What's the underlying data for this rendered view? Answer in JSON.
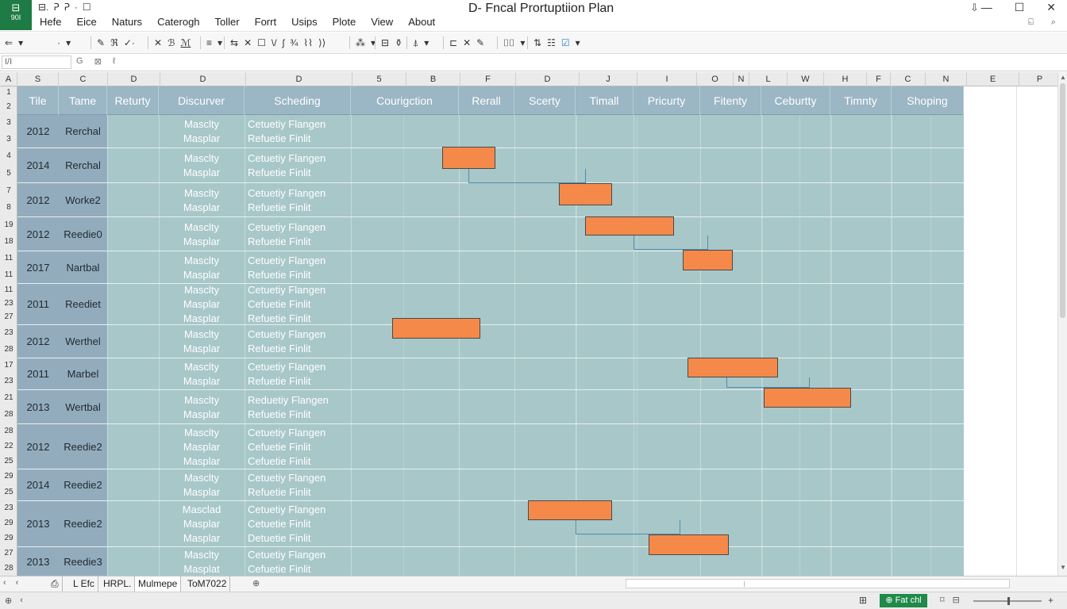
{
  "app": {
    "icon_glyph": "⊟",
    "icon_label": "90I",
    "title": "D- Fncal Prortuptiion Plan",
    "quick_access": [
      "⊟.",
      "ᕈ",
      "ᕈ",
      "·",
      "☐"
    ],
    "menu": [
      "Hefe",
      "Eice",
      "Naturs",
      "Caterogh",
      "Toller",
      "Forrt",
      "Usips",
      "Plote",
      "View",
      "About"
    ],
    "window_controls": [
      "⇩",
      "—",
      "☐",
      "✕"
    ],
    "title_right_icons": [
      "⍇",
      "⌕"
    ]
  },
  "ribbon": {
    "groups": [
      [
        "⇐",
        "▾",
        "·",
        "▾"
      ],
      [
        "✎",
        "ℜ",
        "✓·"
      ],
      [
        "✕",
        "ℬ",
        "ℳ"
      ],
      [
        "≡",
        "▾"
      ],
      [
        "⇆",
        "✕",
        "☐",
        "\\/",
        "ʃ",
        "¾",
        "⌇⌇",
        "⟩⟩"
      ],
      [
        "⁂",
        "▾"
      ],
      [
        "⊟",
        "⚱"
      ],
      [
        "⍋",
        "▾"
      ],
      [
        "⊏",
        "✕",
        "✎"
      ],
      [
        "⌷⌷",
        "▾"
      ],
      [
        "⇅",
        "☷",
        "☑",
        "▾"
      ]
    ]
  },
  "formula_bar": {
    "name_box": "I/I",
    "icons": [
      "G",
      "⊠",
      "ℓ"
    ]
  },
  "columns": [
    "A",
    "S",
    "C",
    "D",
    "D",
    "D",
    "5",
    "B",
    "F",
    "D",
    "J",
    "I",
    "O",
    "N",
    "L",
    "W",
    "H",
    "F",
    "C",
    "N",
    "E",
    "P"
  ],
  "headers": [
    "Tile",
    "Tame",
    "Returty",
    "Discurver",
    "Scheding",
    "Courigction",
    "Rerall",
    "Scerty",
    "Timall",
    "Pricurty",
    "Fitenty",
    "Ceburtty",
    "Timnty",
    "Shoping"
  ],
  "rows": [
    {
      "year": "2012",
      "name": "Rerchal",
      "nums": [
        "3",
        "3"
      ],
      "d": [
        "Masclty",
        "Masplar"
      ],
      "e": [
        "Cetuetiy Flangen",
        "Refuetie Finlit"
      ]
    },
    {
      "year": "2014",
      "name": "Rerchal",
      "nums": [
        "4",
        "5"
      ],
      "d": [
        "Masclty",
        "Masplar"
      ],
      "e": [
        "Cetuetiy Flangen",
        "Refuetie Finlit"
      ]
    },
    {
      "year": "2012",
      "name": "Worke2",
      "nums": [
        "7",
        "8"
      ],
      "d": [
        "Masclty",
        "Masplar"
      ],
      "e": [
        "Cetuetiy Flangen",
        "Refuetie Finlit"
      ]
    },
    {
      "year": "2012",
      "name": "Reedie0",
      "nums": [
        "19",
        "18"
      ],
      "d": [
        "Masclty",
        "Masplar"
      ],
      "e": [
        "Cetuetiy Flangen",
        "Refuetie Finlit"
      ]
    },
    {
      "year": "2017",
      "name": "Nartbal",
      "nums": [
        "11",
        "11"
      ],
      "d": [
        "Masclty",
        "Masplar"
      ],
      "e": [
        "Cetuetiy Flangen",
        "Refuetie Finlit"
      ]
    },
    {
      "year": "2011",
      "name": "Reediet",
      "nums": [
        "11",
        "23",
        "27"
      ],
      "d": [
        "Masclty",
        "Masplar",
        "Masplar"
      ],
      "e": [
        "Cetuetiy Flangen",
        "Cefuetie Finlit",
        "Refuetie Finlit"
      ]
    },
    {
      "year": "2012",
      "name": "Werthel",
      "nums": [
        "23",
        "28"
      ],
      "d": [
        "Masclty",
        "Masplar"
      ],
      "e": [
        "Cetuetiy Flangen",
        "Refuetie Finlit"
      ]
    },
    {
      "year": "2011",
      "name": "Marbel",
      "nums": [
        "17",
        "23"
      ],
      "d": [
        "Masclty",
        "Masplar"
      ],
      "e": [
        "Cetuetiy Flangen",
        "Refuetie Finlit"
      ]
    },
    {
      "year": "2013",
      "name": "Wertbal",
      "nums": [
        "21",
        "28"
      ],
      "d": [
        "Masclty",
        "Masplar"
      ],
      "e": [
        "Reduetiy Flangen",
        "Refuetie Finlit"
      ]
    },
    {
      "year": "2012",
      "name": "Reedie2",
      "nums": [
        "28",
        "22",
        "25"
      ],
      "d": [
        "Masclty",
        "Masplar",
        "Masplar"
      ],
      "e": [
        "Cetuetiy Flangen",
        "Cefuetie Finlit",
        "Cefuetie Finlit"
      ]
    },
    {
      "year": "2014",
      "name": "Reedie2",
      "nums": [
        "29",
        "25"
      ],
      "d": [
        "Masclty",
        "Masplar"
      ],
      "e": [
        "Cetuetiy Flangen",
        "Refuetie Finlit"
      ]
    },
    {
      "year": "2013",
      "name": "Reedie2",
      "nums": [
        "23",
        "29",
        "29"
      ],
      "d": [
        "Masclad",
        "Masplar",
        "Masplar"
      ],
      "e": [
        "Cetuetiy Flangen",
        "Cetuetie Finlit",
        "Detuetie Finlit"
      ]
    },
    {
      "year": "2013",
      "name": "Reedie3",
      "nums": [
        "27",
        "28"
      ],
      "d": [
        "Masclty",
        "Masplat"
      ],
      "e": [
        "Cetuetiy Flangen",
        "Cefuetie Finlit"
      ]
    }
  ],
  "header_row_nums": [
    "1",
    "2"
  ],
  "gantt": {
    "color": "#f4894a",
    "link_color": "#4b8fb0"
  },
  "sheet_tabs": [
    "L Efc",
    "HRPL.",
    "Mulmepe",
    "ToM7022"
  ],
  "tab_nav": [
    "‹",
    "‹"
  ],
  "add_sheet": "⊕",
  "status": {
    "left_icons": [
      "⊕",
      "‹"
    ],
    "badge": "⊕ Fat chl",
    "right_icons": [
      "⌑",
      "⊟"
    ],
    "zoom_plus": "+"
  },
  "colors": {
    "accent": "#1e7b45",
    "header_fill": "#9bb6c4",
    "body_fill": "#a8c7c9",
    "label_fill": "#93acbd"
  }
}
